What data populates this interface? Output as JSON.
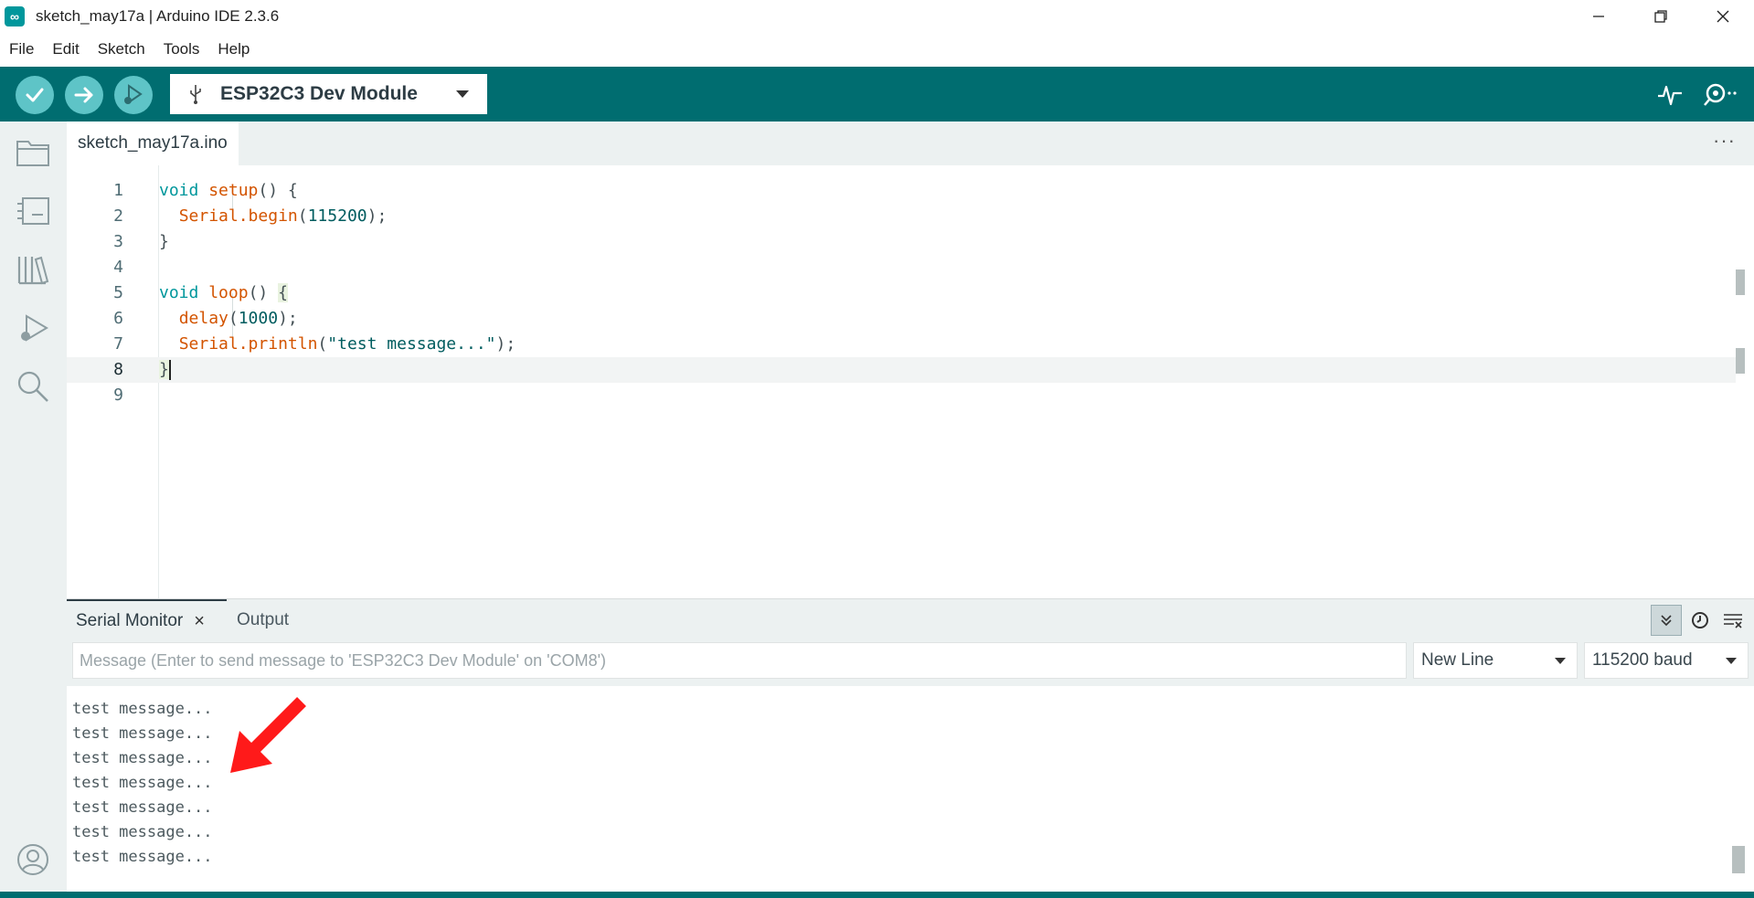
{
  "window": {
    "title": "sketch_may17a | Arduino IDE 2.3.6",
    "logo_icon": "arduino-infinity-icon"
  },
  "menu": [
    "File",
    "Edit",
    "Sketch",
    "Tools",
    "Help"
  ],
  "toolbar": {
    "verify": "check-icon",
    "upload": "arrow-right-icon",
    "debug": "debug-icon",
    "board": "ESP32C3 Dev Module",
    "serial_plotter": "plotter-icon",
    "serial_monitor": "serial-monitor-icon"
  },
  "sidebar": [
    "folder-icon",
    "board-manager-icon",
    "library-icon",
    "debug-icon",
    "search-icon",
    "account-icon"
  ],
  "tabs": {
    "file": "sketch_may17a.ino",
    "more": "···"
  },
  "code": {
    "current_line": 8,
    "lines": [
      {
        "n": "1"
      },
      {
        "n": "2"
      },
      {
        "n": "3"
      },
      {
        "n": "4"
      },
      {
        "n": "5"
      },
      {
        "n": "6"
      },
      {
        "n": "7"
      },
      {
        "n": "8"
      },
      {
        "n": "9"
      }
    ],
    "tokens": {
      "void": "void",
      "setup": "setup",
      "paren_brace": "() {",
      "serial": "Serial",
      "begin": ".begin",
      "baud": "115200",
      "semi": ");",
      "open_paren": "(",
      "close_brace": "}",
      "loop": "loop",
      "open_brace": "{",
      "delay": "delay",
      "ms": "1000",
      "println": ".println",
      "message": "\"test message...\""
    }
  },
  "panel": {
    "tab_serial": "Serial Monitor",
    "tab_output": "Output",
    "close_symbol": "×",
    "placeholder": "Message (Enter to send message to 'ESP32C3 Dev Module' on 'COM8')",
    "line_ending": "New Line",
    "baud_rate": "115200 baud",
    "autoscroll_icon": "double-chevron-down-icon",
    "timestamp_icon": "clock-icon",
    "clear_icon": "clear-output-icon"
  },
  "serial_output": [
    "test message...",
    "test message...",
    "test message...",
    "test message...",
    "test message...",
    "test message...",
    "test message..."
  ],
  "colors": {
    "toolbar": "#006d70",
    "button": "#5ec4c7",
    "annotation_arrow": "#ff1a1a"
  }
}
